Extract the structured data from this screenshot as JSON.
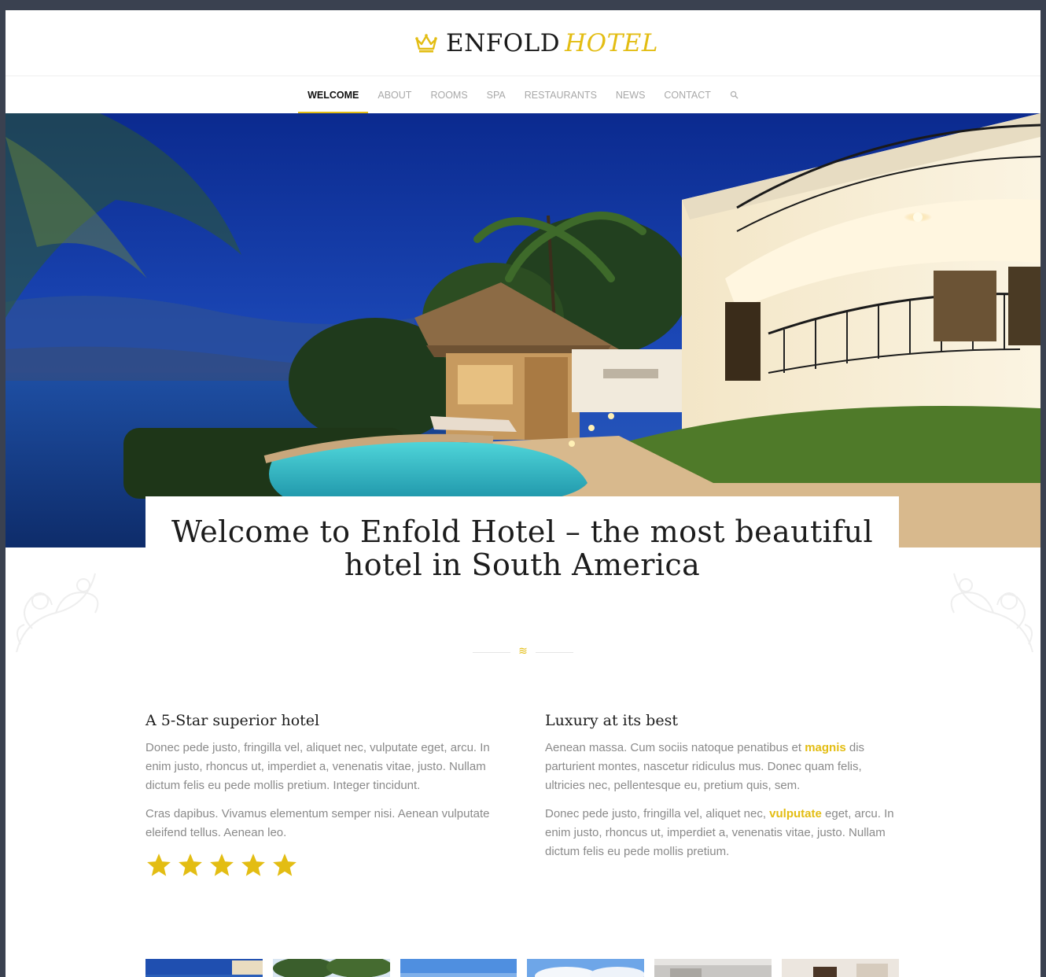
{
  "header": {
    "logo_main": "ENFOLD",
    "logo_accent": "HOTEL",
    "accent_color": "#e3bd13"
  },
  "nav": {
    "items": [
      {
        "label": "WELCOME"
      },
      {
        "label": "ABOUT"
      },
      {
        "label": "ROOMS"
      },
      {
        "label": "SPA"
      },
      {
        "label": "RESTAURANTS"
      },
      {
        "label": "NEWS"
      },
      {
        "label": "CONTACT"
      }
    ],
    "active": "WELCOME",
    "search_icon": "search-icon"
  },
  "hero": {
    "image": "hotel-exterior-at-dusk-with-pool"
  },
  "welcome": {
    "heading": "Welcome to Enfold Hotel – the most beautiful hotel in South America"
  },
  "columns": {
    "left": {
      "heading": "A 5-Star superior hotel",
      "p1": "Donec pede justo, fringilla vel, aliquet nec, vulputate eget, arcu. In enim justo, rhoncus ut, imperdiet a, venenatis vitae, justo. Nullam dictum felis eu pede mollis pretium. Integer tincidunt.",
      "p2": "Cras dapibus. Vivamus elementum semper nisi. Aenean vulputate eleifend tellus. Aenean leo.",
      "rating": 5
    },
    "right": {
      "heading": "Luxury at its best",
      "p1_before": "Aenean massa. Cum sociis natoque penatibus et ",
      "p1_highlight": "magnis",
      "p1_after": " dis parturient montes, nascetur ridiculus mus. Donec quam felis, ultricies nec, pellentesque eu, pretium quis, sem.",
      "p2_before": "Donec pede justo, fringilla vel, aliquet nec, ",
      "p2_highlight": "vulputate",
      "p2_after": " eget, arcu. In enim justo, rhoncus ut, imperdiet a, venenatis vitae, justo. Nullam dictum felis eu pede mollis pretium."
    }
  },
  "thumbnails": [
    {
      "name": "thumb-1"
    },
    {
      "name": "thumb-2"
    },
    {
      "name": "thumb-3"
    },
    {
      "name": "thumb-4"
    },
    {
      "name": "thumb-5"
    },
    {
      "name": "thumb-6"
    }
  ]
}
